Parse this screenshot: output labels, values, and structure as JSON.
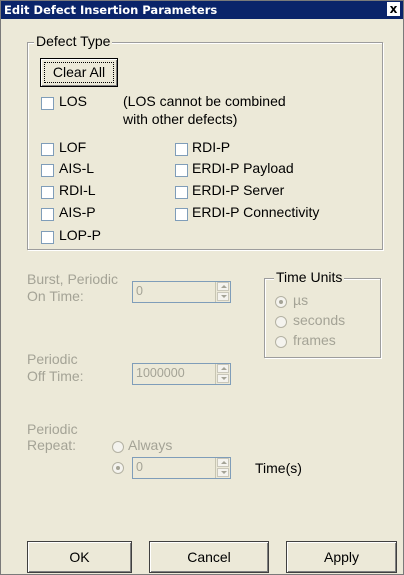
{
  "window": {
    "title": "Edit Defect Insertion Parameters",
    "close_glyph": "x"
  },
  "defect_type": {
    "legend": "Defect Type",
    "clear_all": "Clear All",
    "los": {
      "label": "LOS",
      "note_line1": "(LOS cannot be combined",
      "note_line2": "with other defects)"
    },
    "left_items": [
      "LOF",
      "AIS-L",
      "RDI-L",
      "AIS-P",
      "LOP-P"
    ],
    "right_items": [
      "RDI-P",
      "ERDI-P Payload",
      "ERDI-P Server",
      "ERDI-P Connectivity"
    ]
  },
  "burst": {
    "label_line1": "Burst, Periodic",
    "label_line2": "On Time:",
    "value": "0"
  },
  "time_units": {
    "legend": "Time Units",
    "options": [
      "µs",
      "seconds",
      "frames"
    ],
    "selected": "µs"
  },
  "periodic_off": {
    "label_line1": "Periodic",
    "label_line2": "Off Time:",
    "value": "1000000"
  },
  "periodic_repeat": {
    "label_line1": "Periodic",
    "label_line2": "Repeat:",
    "always": "Always",
    "count_value": "0",
    "suffix": "Time(s)"
  },
  "buttons": {
    "ok": "OK",
    "cancel": "Cancel",
    "apply": "Apply"
  }
}
